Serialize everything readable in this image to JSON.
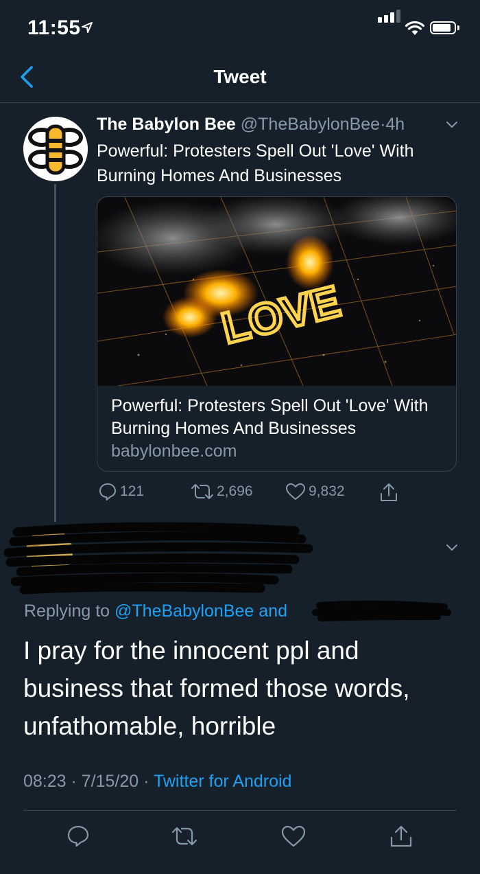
{
  "status_bar": {
    "time": "11:55",
    "battery_level": 0.8
  },
  "nav": {
    "title": "Tweet"
  },
  "tweet": {
    "author_name": "The Babylon Bee",
    "handle": "@TheBabylonBee",
    "separator": "·",
    "time_ago": "4h",
    "text": "Powerful: Protesters Spell Out 'Love' With Burning Homes And Businesses",
    "card": {
      "image_text": "LOVE",
      "title": "Powerful: Protesters Spell Out 'Love' With Burning Homes And Businesses",
      "domain": "babylonbee.com"
    },
    "actions": {
      "replies": "121",
      "retweets": "2,696",
      "likes": "9,832"
    }
  },
  "reply": {
    "replying_prefix": "Replying to ",
    "replying_handle": "@TheBabylonBee",
    "replying_and": " and ",
    "text": "I pray for the innocent ppl and business that formed those words, unfathomable, horrible",
    "time": "08:23",
    "sep": " · ",
    "date": "7/15/20",
    "source": "Twitter for Android"
  },
  "colors": {
    "background": "#15202b",
    "text": "#ffffff",
    "muted": "#8899a6",
    "link": "#1da1f2",
    "divider": "#38444d",
    "brand_yellow": "#f5b82e"
  },
  "icons": [
    "location-arrow-icon",
    "signal-icon",
    "wifi-icon",
    "battery-icon",
    "back-chevron-icon",
    "chevron-down-icon",
    "reply-icon",
    "retweet-icon",
    "like-icon",
    "share-icon"
  ]
}
